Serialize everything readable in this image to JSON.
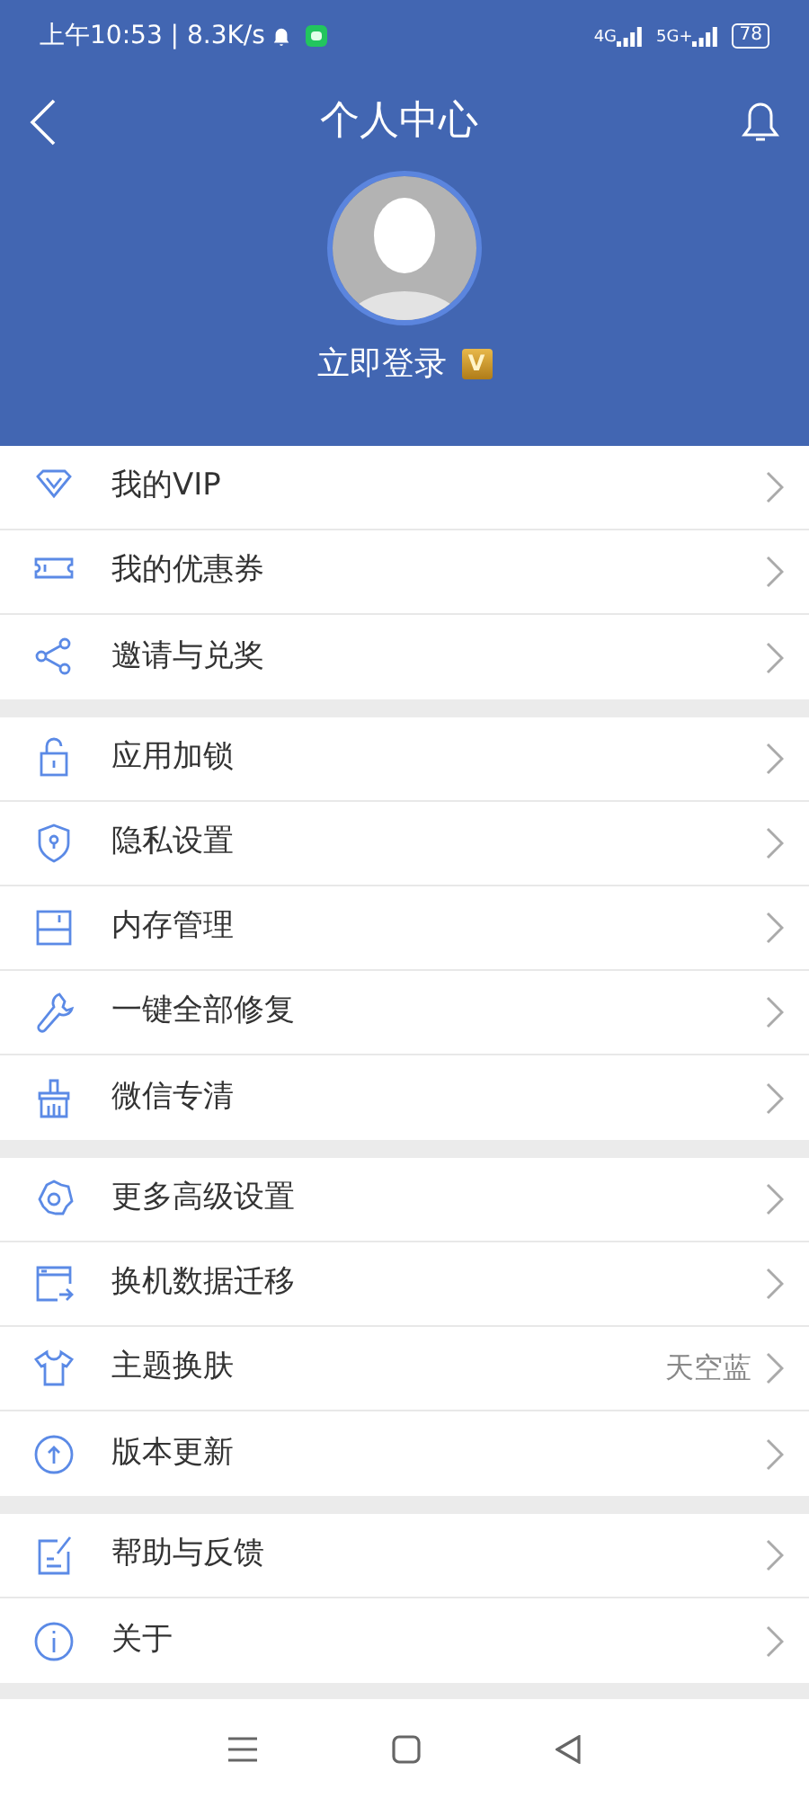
{
  "status_bar": {
    "time": "上午10:53 | 8.3K/s",
    "network_1": "4G",
    "network_2": "5G+",
    "battery": "78"
  },
  "header": {
    "title": "个人中心",
    "login": "立即登录",
    "vip_badge": "V"
  },
  "groups": [
    {
      "items": [
        {
          "label": "我的VIP"
        },
        {
          "label": "我的优惠券"
        },
        {
          "label": "邀请与兑奖"
        }
      ]
    },
    {
      "items": [
        {
          "label": "应用加锁"
        },
        {
          "label": "隐私设置"
        },
        {
          "label": "内存管理"
        },
        {
          "label": "一键全部修复"
        },
        {
          "label": "微信专清"
        }
      ]
    },
    {
      "items": [
        {
          "label": "更多高级设置"
        },
        {
          "label": "换机数据迁移"
        },
        {
          "label": "主题换肤",
          "value": "天空蓝"
        },
        {
          "label": "版本更新"
        }
      ]
    },
    {
      "items": [
        {
          "label": "帮助与反馈"
        },
        {
          "label": "关于"
        }
      ]
    }
  ]
}
